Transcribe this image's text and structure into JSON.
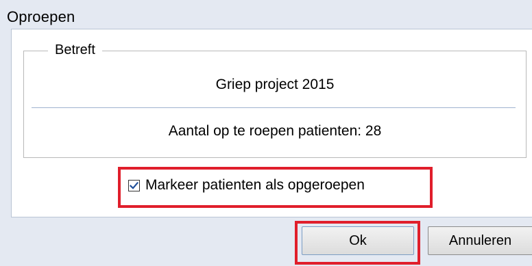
{
  "window": {
    "title": "Oproepen"
  },
  "group": {
    "legend": "Betreft",
    "subject": "Griep project 2015",
    "count_text": "Aantal op te roepen patienten: 28"
  },
  "options": {
    "mark_called_label": "Markeer patienten als opgeroepen",
    "mark_called_checked": true
  },
  "buttons": {
    "ok_label": "Ok",
    "cancel_label": "Annuleren"
  },
  "colors": {
    "highlight": "#e01e2b",
    "dialog_background": "#e4e9f2",
    "check_mark": "#1f4f9a"
  }
}
